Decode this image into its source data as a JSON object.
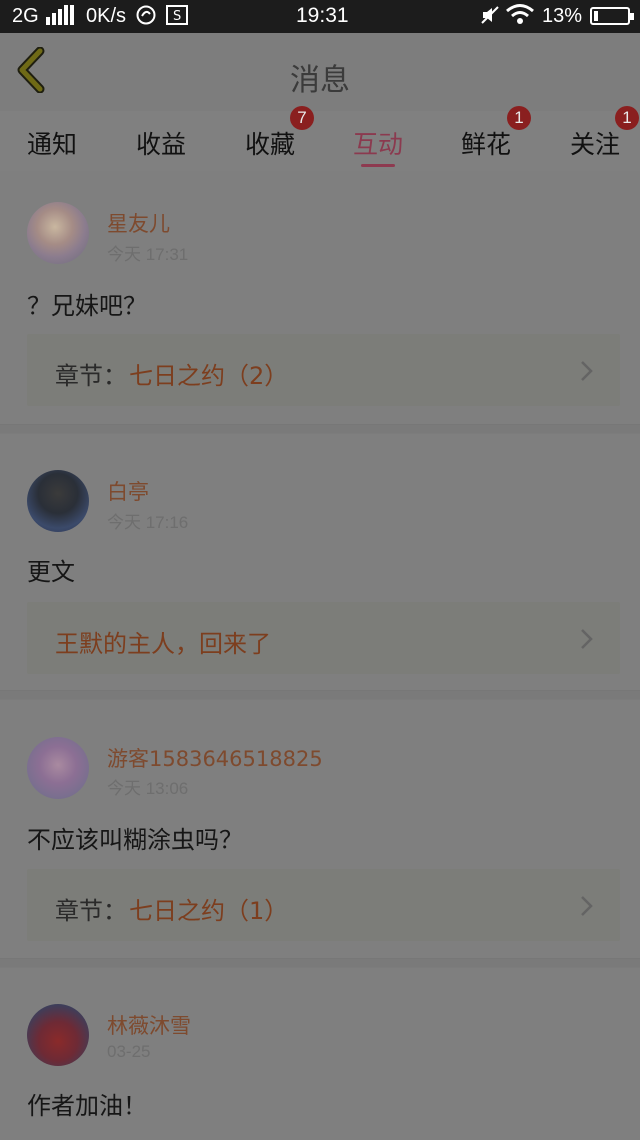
{
  "status_bar": {
    "network": "2G",
    "speed": "0K/s",
    "time": "19:31",
    "battery": "13%",
    "battery_level": 0.13,
    "icons": [
      "signal-icon",
      "sync-icon",
      "screenshot-icon",
      "mute-icon",
      "wifi-icon",
      "battery-icon"
    ]
  },
  "header": {
    "title": "消息",
    "back_icon": "chevron-left-icon"
  },
  "tabs": [
    {
      "label": "通知",
      "badge": ""
    },
    {
      "label": "收益",
      "badge": ""
    },
    {
      "label": "收藏",
      "badge": "7"
    },
    {
      "label": "互动",
      "badge": "",
      "active": true
    },
    {
      "label": "鲜花",
      "badge": "1"
    },
    {
      "label": "关注",
      "badge": "1"
    }
  ],
  "messages": [
    {
      "user": "星友儿",
      "time": "今天 17:31",
      "content": "？兄妹吧？",
      "ref_label": "章节：",
      "ref_link": "七日之约（2）"
    },
    {
      "user": "白亭",
      "time": "今天 17:16",
      "content": "更文",
      "ref_label": "",
      "ref_link": "王默的主人，回来了"
    },
    {
      "user": "游客1583646518825",
      "time": "今天 13:06",
      "content": "不应该叫糊涂虫吗？",
      "ref_label": "章节：",
      "ref_link": "七日之约（1）"
    },
    {
      "user": "林薇沐雪",
      "time": "03-25",
      "content": "作者加油！"
    }
  ],
  "colors": {
    "accent": "#8e3a50",
    "badge": "#8a1f1f",
    "username": "#7e4a2e",
    "link": "#7d3e1e"
  }
}
